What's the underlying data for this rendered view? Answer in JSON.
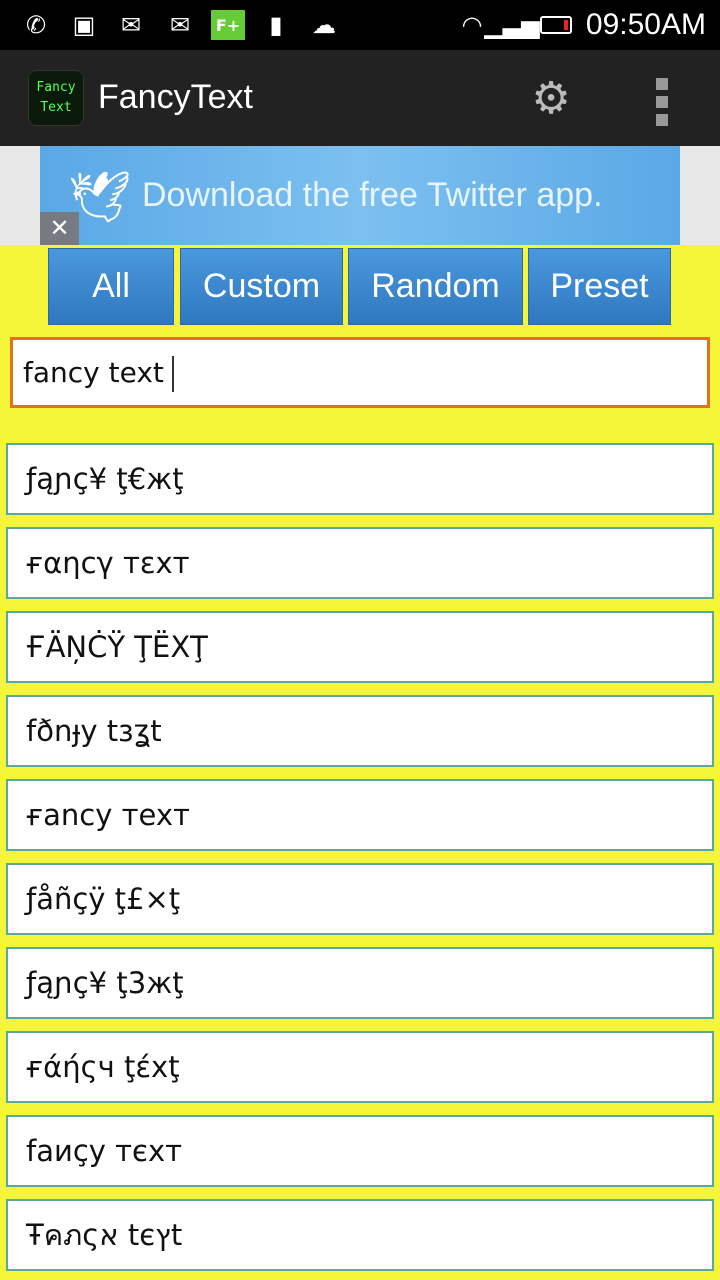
{
  "status_bar": {
    "time": "09:50AM",
    "icons": [
      "whatsapp-icon",
      "gallery-icon",
      "gmail-icon",
      "email-icon",
      "fplus-icon",
      "flashlight-icon",
      "weather-icon",
      "wifi-icon",
      "signal-icon",
      "battery-icon"
    ]
  },
  "app_bar": {
    "title": "FancyText",
    "logo_text": [
      "Fancy",
      "Text"
    ]
  },
  "ad": {
    "text": "Download the free Twitter app.",
    "close": "✕"
  },
  "tabs": [
    {
      "label": "All"
    },
    {
      "label": "Custom"
    },
    {
      "label": "Random"
    },
    {
      "label": "Preset"
    }
  ],
  "input": {
    "value": "fancy text"
  },
  "results": [
    "ƒąɲç¥ ţ€жţ",
    "ғαηcγ тεхт",
    "ҒÄŅĊŸ ŢЁХŢ",
    "fðnɟy tɜʓt",
    "ғancy тexт",
    "ƒåñçÿ ţ£×ţ",
    "ƒąɲç¥ ţ3жţ",
    "ғάήςч ţέxţ",
    "faиçy тєxт",
    "Ŧคภςא tєץt"
  ],
  "colors": {
    "background": "#f5f53a",
    "tab": "#3a88d0",
    "input_border": "#e8701a",
    "item_border": "#5aa8a0"
  }
}
